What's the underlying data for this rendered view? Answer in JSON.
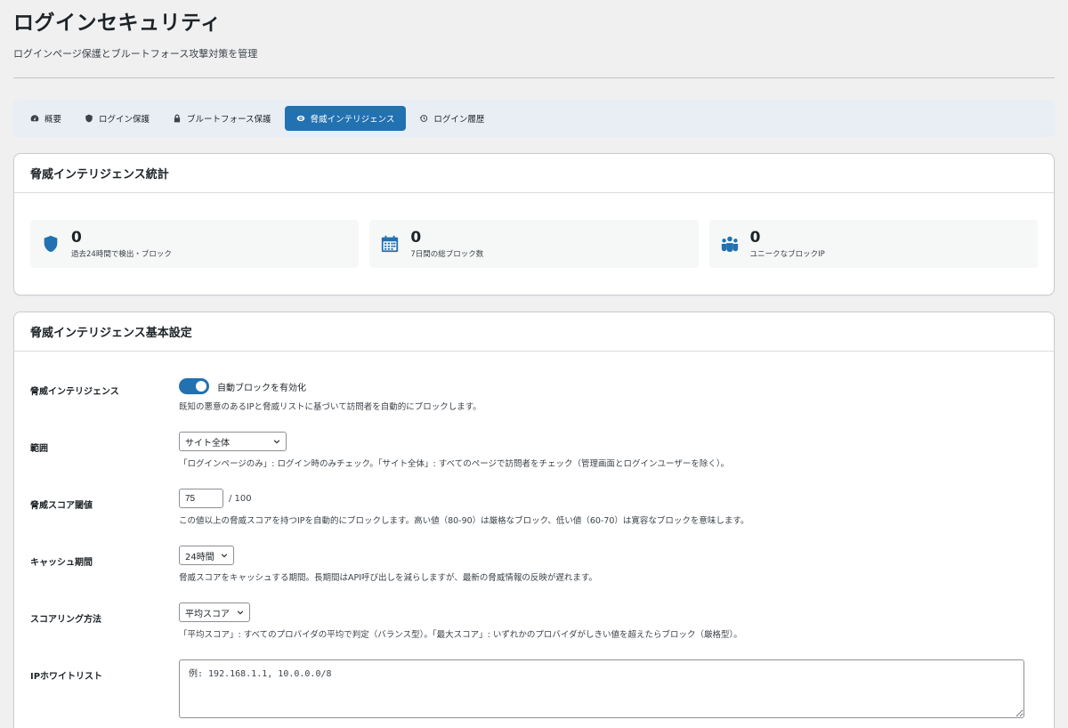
{
  "header": {
    "title": "ログインセキュリティ",
    "subtitle": "ログインページ保護とブルートフォース攻撃対策を管理"
  },
  "tabs": [
    {
      "label": "概要",
      "icon": "dashboard-icon",
      "active": false
    },
    {
      "label": "ログイン保護",
      "icon": "shield-icon",
      "active": false
    },
    {
      "label": "ブルートフォース保護",
      "icon": "lock-icon",
      "active": false
    },
    {
      "label": "脅威インテリジェンス",
      "icon": "eye-icon",
      "active": true
    },
    {
      "label": "ログイン履歴",
      "icon": "history-icon",
      "active": false
    }
  ],
  "stats_card": {
    "title": "脅威インテリジェンス統計",
    "items": [
      {
        "value": "0",
        "label": "過去24時間で検出・ブロック",
        "icon": "shield-icon"
      },
      {
        "value": "0",
        "label": "7日間の総ブロック数",
        "icon": "calendar-icon"
      },
      {
        "value": "0",
        "label": "ユニークなブロックIP",
        "icon": "groups-icon"
      }
    ]
  },
  "settings_card": {
    "title": "脅威インテリジェンス基本設定",
    "threat_intel": {
      "label": "脅威インテリジェンス",
      "toggle_label": "自動ブロックを有効化",
      "toggle_on": true,
      "description": "既知の悪意のあるIPと脅威リストに基づいて訪問者を自動的にブロックします。"
    },
    "scope": {
      "label": "範囲",
      "selected": "サイト全体",
      "description": "「ログインページのみ」: ログイン時のみチェック。「サイト全体」: すべてのページで訪問者をチェック（管理画面とログインユーザーを除く）。"
    },
    "threshold": {
      "label": "脅威スコア閾値",
      "value": "75",
      "suffix": "/ 100",
      "description": "この値以上の脅威スコアを持つIPを自動的にブロックします。高い値（80-90）は厳格なブロック、低い値（60-70）は寛容なブロックを意味します。"
    },
    "cache": {
      "label": "キャッシュ期間",
      "selected": "24時間",
      "description": "脅威スコアをキャッシュする期間。長期間はAPI呼び出しを減らしますが、最新の脅威情報の反映が遅れます。"
    },
    "scoring": {
      "label": "スコアリング方法",
      "selected": "平均スコア",
      "description": "「平均スコア」: すべてのプロバイダの平均で判定（バランス型）。「最大スコア」: いずれかのプロバイダがしきい値を超えたらブロック（厳格型）。"
    },
    "whitelist": {
      "label": "IPホワイトリスト",
      "placeholder": "例: 192.168.1.1, 10.0.0.0/8"
    }
  },
  "colors": {
    "accent": "#2271b1",
    "tab_bar_bg": "#e9eef5",
    "page_bg": "#f0f0f1"
  }
}
